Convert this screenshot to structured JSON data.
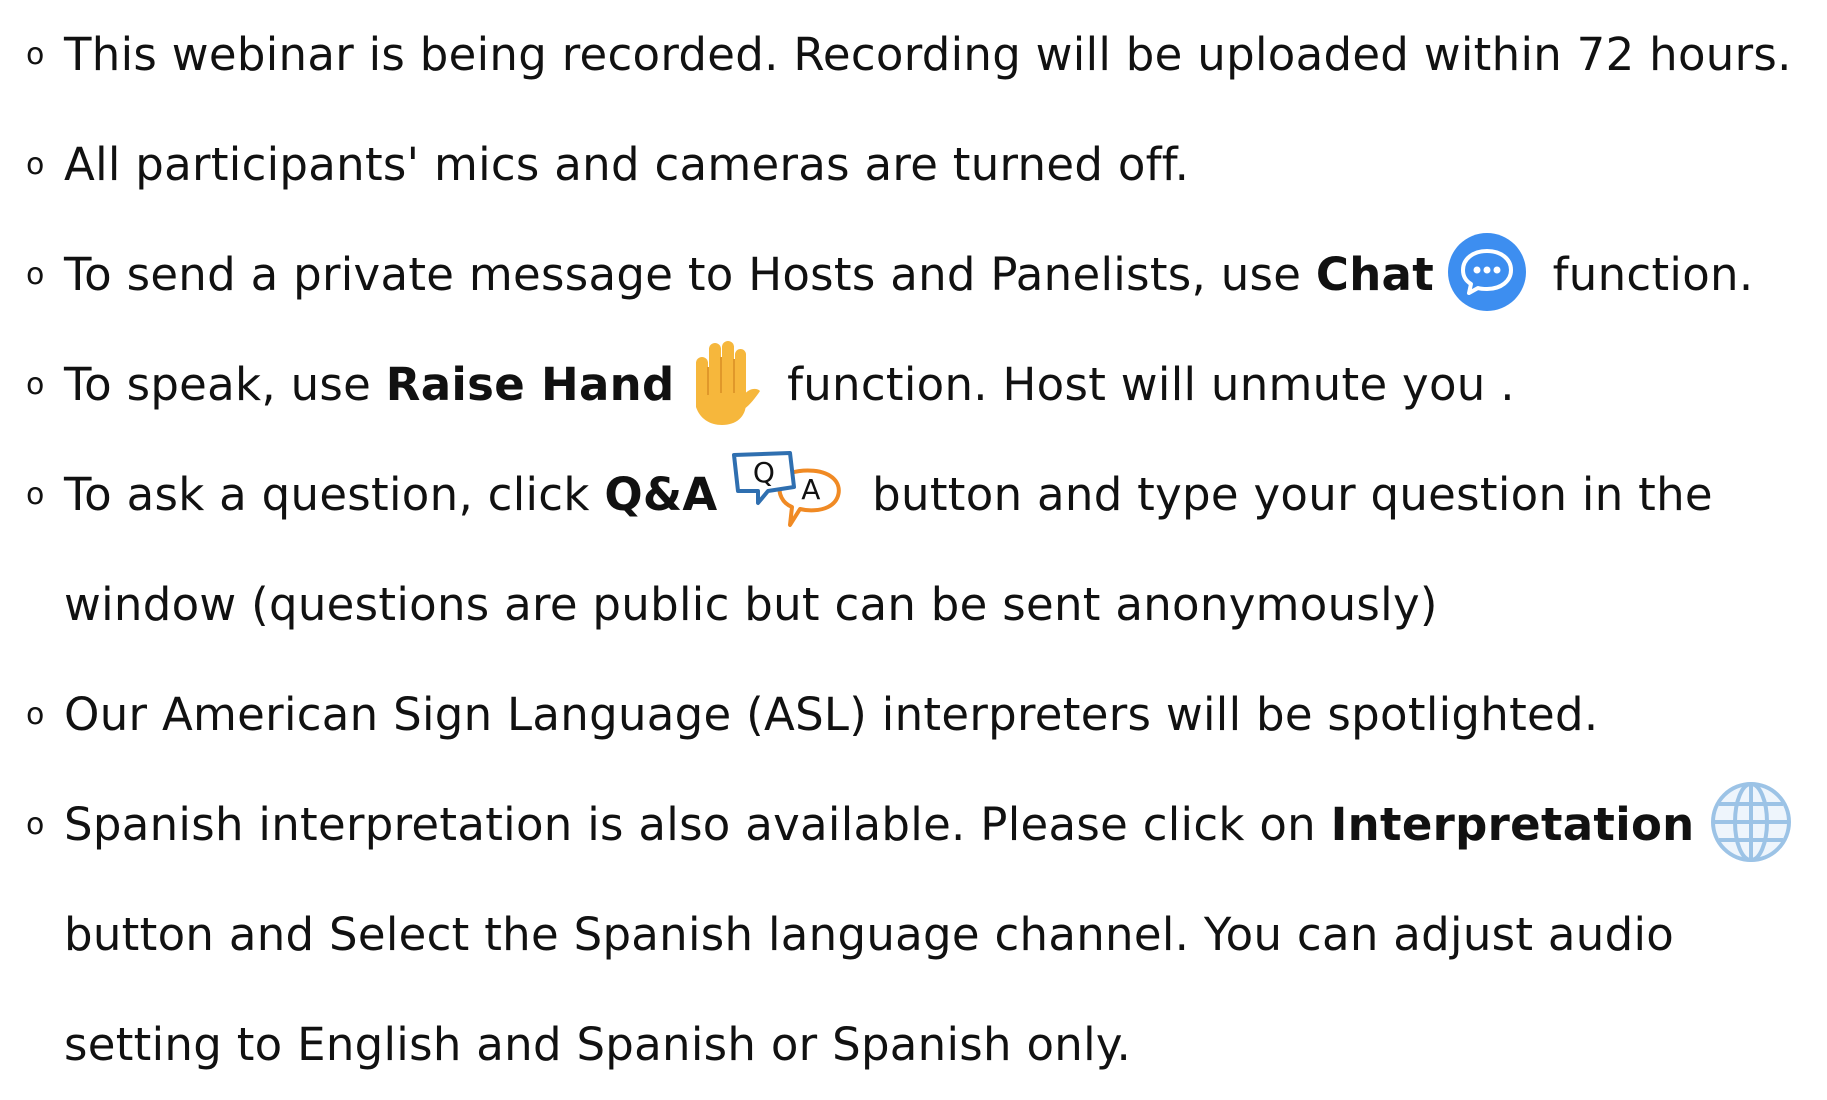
{
  "bullet": "o",
  "items": [
    {
      "text": "This webinar is being recorded. Recording will be uploaded within 72 hours."
    },
    {
      "text": "All participants' mics and cameras are turned off."
    },
    {
      "before": "To send a private message to Hosts and Panelists, use ",
      "bold": "Chat",
      "icon": "chat-bubble-icon",
      "after": " function."
    },
    {
      "before": "To speak, use ",
      "bold": "Raise Hand",
      "icon": "raised-hand-icon",
      "after": " function. Host will unmute you ."
    },
    {
      "before": "To ask a question, click ",
      "bold": "Q&A",
      "icon": "q-and-a-icon",
      "icon_letters": [
        "Q",
        "A"
      ],
      "after": " button and type your question in the window (questions are public but can be sent anonymously)"
    },
    {
      "text": "Our American Sign Language (ASL) interpreters will be spotlighted."
    },
    {
      "before": "Spanish interpretation is also available. Please click on ",
      "bold": "Interpretation",
      "icon": "globe-icon",
      "after": " button and Select the Spanish language channel. You can adjust audio setting to English and Spanish or Spanish only."
    }
  ],
  "colors": {
    "text": "#111111",
    "chat_icon": "#3d8ef0",
    "hand_icon": "#f6b73c",
    "qa_q": "#2f6fb0",
    "qa_a": "#f08a24",
    "globe": "#9cc3e6"
  }
}
